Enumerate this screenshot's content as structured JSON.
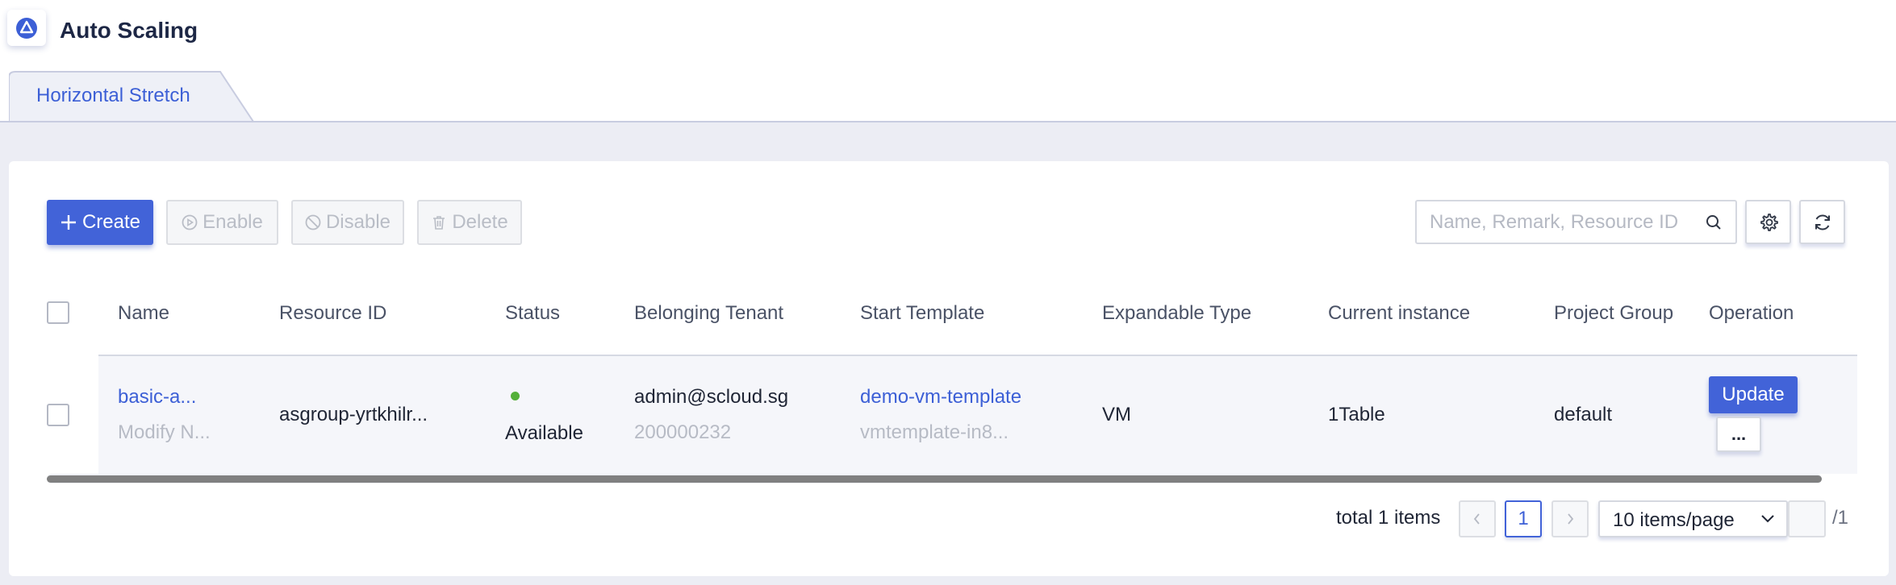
{
  "app": {
    "title": "Auto Scaling",
    "logo_icon": "triangle-logo-icon",
    "accent": "#4263d8"
  },
  "tabs": [
    {
      "label": "Horizontal Stretch",
      "active": true
    }
  ],
  "toolbar": {
    "create_label": "Create",
    "enable_label": "Enable",
    "disable_label": "Disable",
    "delete_label": "Delete",
    "search_placeholder": "Name, Remark, Resource ID",
    "settings_icon": "gear-icon",
    "refresh_icon": "refresh-icon"
  },
  "table": {
    "columns": [
      "Name",
      "Resource ID",
      "Status",
      "Belonging Tenant",
      "Start Template",
      "Expandable Type",
      "Current instance",
      "Project Group",
      "Operation"
    ],
    "rows": [
      {
        "name": "basic-a...",
        "remark": "Modify N...",
        "resource_id": "asgroup-yrtkhilr...",
        "status": "Available",
        "status_color": "#55b03a",
        "tenant": "admin@scloud.sg",
        "tenant_id": "200000232",
        "template": "demo-vm-template",
        "template_id": "vmtemplate-in8...",
        "expandable_type": "VM",
        "current_instance": "1Table",
        "project_group": "default",
        "update_label": "Update",
        "more_label": "..."
      }
    ]
  },
  "pagination": {
    "total_text": "total 1 items",
    "current_page": "1",
    "page_size_label": "10 items/page",
    "goto_value": "",
    "total_pages_text": "/1"
  }
}
